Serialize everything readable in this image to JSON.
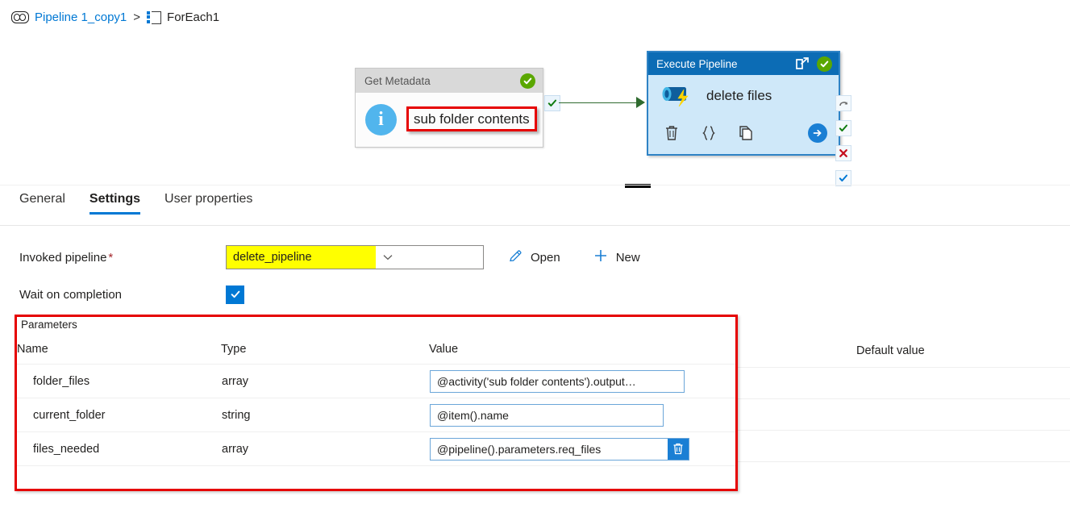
{
  "breadcrumb": {
    "pipeline_icon": "pipeline-icon",
    "pipeline_label": "Pipeline 1_copy1",
    "separator": ">",
    "foreach_icon": "foreach-icon",
    "current_label": "ForEach1"
  },
  "canvas": {
    "get_metadata": {
      "header_title": "Get Metadata",
      "status_icon": "green-check-icon",
      "type_icon": "info-icon",
      "activity_name": "sub folder contents",
      "highlight_color": "#e60000",
      "output_handle_icon": "green-check-handle-icon"
    },
    "execute_pipeline": {
      "header_title": "Execute Pipeline",
      "open_icon": "open-in-new-icon",
      "status_icon": "green-check-icon",
      "type_icon": "execute-pipeline-icon",
      "activity_name": "delete files",
      "footer_icons": [
        "trash-icon",
        "braces-icon",
        "copy-icon"
      ],
      "go_icon": "arrow-right-circle-icon",
      "selected_border_color": "#2f83c5",
      "header_color": "#0c6cb5",
      "body_color": "#cfe8f9",
      "handles": [
        {
          "icon": "skip-arrow-icon",
          "color": "#6e6e6e"
        },
        {
          "icon": "success-check-icon",
          "color": "#107c10"
        },
        {
          "icon": "failure-x-icon",
          "color": "#c50f1f"
        },
        {
          "icon": "completion-check-icon",
          "color": "#0078d4"
        }
      ]
    },
    "connector": {
      "color": "#2f6b2f",
      "arrow_icon": "arrow-head-icon"
    },
    "resize_handle": "canvas-resize-handle"
  },
  "tabs": [
    {
      "label": "General",
      "active": false
    },
    {
      "label": "Settings",
      "active": true
    },
    {
      "label": "User properties",
      "active": false
    }
  ],
  "settings": {
    "invoked_pipeline": {
      "label": "Invoked pipeline",
      "required_marker": "*",
      "value": "delete_pipeline",
      "highlight_color": "#ffff00",
      "caret_icon": "chevron-down-icon",
      "open_button": {
        "icon": "pencil-icon",
        "label": "Open"
      },
      "new_button": {
        "icon": "plus-icon",
        "label": "New"
      }
    },
    "wait_on_completion": {
      "label": "Wait on completion",
      "checked": true,
      "check_icon": "checkmark-icon",
      "accent_color": "#0078d4"
    },
    "parameters": {
      "caption": "Parameters",
      "annotation_color": "#e60000",
      "columns": [
        "Name",
        "Type",
        "Value",
        "Default value"
      ],
      "rows": [
        {
          "name": "folder_files",
          "type": "array",
          "value": "@activity('sub folder contents').output…",
          "default_value": "",
          "has_delete": false
        },
        {
          "name": "current_folder",
          "type": "string",
          "value": "@item().name",
          "default_value": "",
          "has_delete": false
        },
        {
          "name": "files_needed",
          "type": "array",
          "value": "@pipeline().parameters.req_files",
          "default_value": "",
          "has_delete": true,
          "delete_icon": "trash-icon"
        }
      ]
    }
  }
}
